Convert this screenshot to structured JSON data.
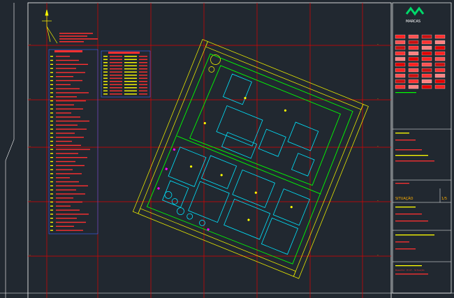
{
  "drawing": {
    "sheet_title": "SITUAÇÃO",
    "sheet_code": "1/5",
    "company": "MARCAS",
    "legend_header": "Legenda",
    "table_header": "Tabela",
    "north_label": "N",
    "footer_label": "Desenho: Prof. Situação",
    "colors": {
      "background": "#212830",
      "grid": "#e00000",
      "frame": "#ffffff",
      "text_yellow": "#ffff00",
      "text_red": "#ff3030",
      "building_cyan": "#00e5ff",
      "site_green": "#00ff00",
      "road_yellow": "#e5e500",
      "accent_magenta": "#ff00ff"
    },
    "icons": [
      "north-arrow-icon",
      "company-logo-icon"
    ]
  }
}
